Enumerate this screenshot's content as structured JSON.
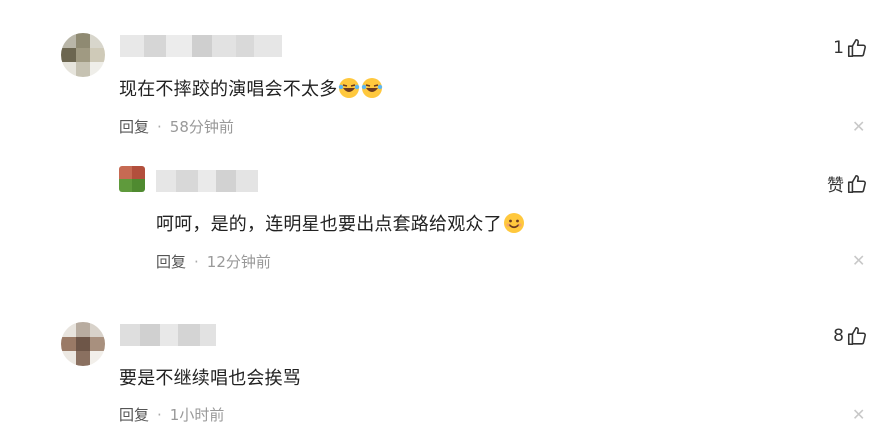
{
  "comments": [
    {
      "text": "现在不摔跤的演唱会不太多",
      "time": "58分钟前",
      "reply_label": "回复",
      "like_count": "1",
      "emojis": [
        "laugh-cry-emoji",
        "laugh-cry-emoji"
      ]
    },
    {
      "text": "呵呵，是的，连明星也要出点套路给观众了",
      "time": "12分钟前",
      "reply_label": "回复",
      "like_count": "赞",
      "emojis": [
        "smile-emoji"
      ]
    },
    {
      "text": "要是不继续唱也会挨骂",
      "time": "1小时前",
      "reply_label": "回复",
      "like_count": "8",
      "emojis": []
    }
  ],
  "separator": "·",
  "close_symbol": "✕",
  "icons": {
    "like": "thumbs-up-icon",
    "close": "close-icon"
  },
  "colors": {
    "meta_text": "#999999",
    "emoji_face": "#FFC83D"
  }
}
